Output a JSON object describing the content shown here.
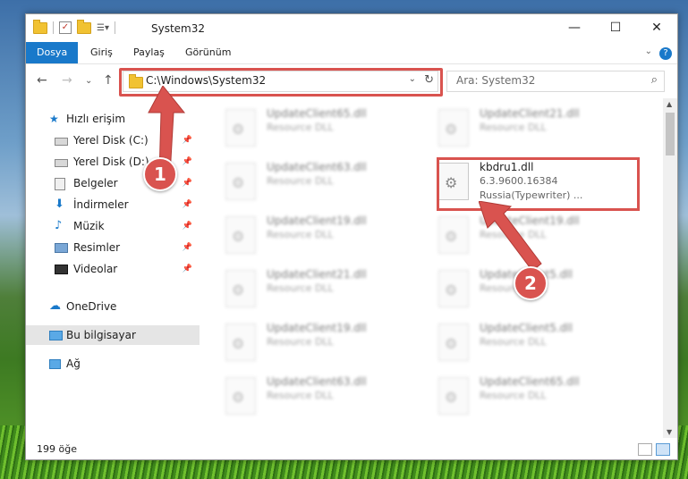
{
  "window": {
    "title": "System32"
  },
  "ribbon": {
    "tabs": [
      "Dosya",
      "Giriş",
      "Paylaş",
      "Görünüm"
    ],
    "help": "?"
  },
  "nav": {
    "address": "C:\\Windows\\System32",
    "search_placeholder": "Ara: System32"
  },
  "sidebar": {
    "items": [
      {
        "label": "Hızlı erişim",
        "icon": "star-icon"
      },
      {
        "label": "Yerel Disk (C:)",
        "icon": "drive-icon",
        "pinned": true
      },
      {
        "label": "Yerel Disk (D:)",
        "icon": "drive-icon",
        "pinned": true
      },
      {
        "label": "Belgeler",
        "icon": "documents-icon",
        "pinned": true
      },
      {
        "label": "İndirmeler",
        "icon": "download-icon",
        "pinned": true
      },
      {
        "label": "Müzik",
        "icon": "music-icon",
        "pinned": true
      },
      {
        "label": "Resimler",
        "icon": "pictures-icon",
        "pinned": true
      },
      {
        "label": "Videolar",
        "icon": "videos-icon",
        "pinned": true
      },
      {
        "label": "OneDrive",
        "icon": "cloud-icon"
      },
      {
        "label": "Bu bilgisayar",
        "icon": "computer-icon",
        "selected": true
      },
      {
        "label": "Ağ",
        "icon": "network-icon"
      }
    ]
  },
  "files": {
    "left": [
      {
        "name": "UpdateClient65.dll",
        "type": "Resource DLL"
      },
      {
        "name": "UpdateClient63.dll",
        "type": "Resource DLL"
      },
      {
        "name": "UpdateClient19.dll",
        "type": "Resource DLL"
      },
      {
        "name": "UpdateClient21.dll",
        "type": "Resource DLL"
      },
      {
        "name": "UpdateClient19.dll",
        "type": "Resource DLL"
      },
      {
        "name": "UpdateClient63.dll",
        "type": "Resource DLL"
      }
    ],
    "right": [
      {
        "name": "UpdateClient21.dll",
        "type": "Resource DLL"
      },
      {
        "name": "UpdateClient19.dll",
        "type": "Resource DLL"
      },
      {
        "name": "UpdateClient5.dll",
        "type": "Resource DLL"
      },
      {
        "name": "UpdateClient5.dll",
        "type": "Resource DLL"
      },
      {
        "name": "UpdateClient65.dll",
        "type": "Resource DLL"
      }
    ],
    "highlighted": {
      "name": "kbdru1.dll",
      "version": "6.3.9600.16384",
      "description": "Russia(Typewriter) ..."
    }
  },
  "status": {
    "count": "199 öğe"
  },
  "markers": {
    "one": "1",
    "two": "2"
  },
  "colors": {
    "accent": "#1979ca",
    "highlight": "#d9534f"
  }
}
